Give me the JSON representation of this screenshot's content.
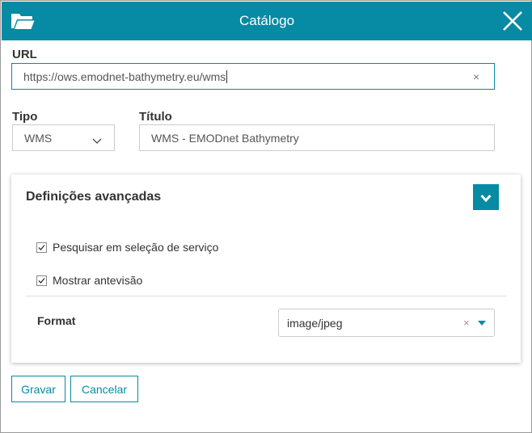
{
  "header": {
    "title": "Catálogo",
    "folder_icon": "folder-open-icon",
    "close_icon": "close-icon"
  },
  "form": {
    "url_label": "URL",
    "url_value": "https://ows.emodnet-bathymetry.eu/wms",
    "url_clear": "×",
    "type_label": "Tipo",
    "type_value": "WMS",
    "title_label": "Título",
    "title_value": "WMS - EMODnet Bathymetry"
  },
  "advanced": {
    "title": "Definições avançadas",
    "toggle_icon": "chevron-down-icon",
    "options": [
      {
        "label": "Pesquisar em seleção de serviço",
        "checked": true
      },
      {
        "label": "Mostrar antevisão",
        "checked": true
      }
    ],
    "format_label": "Format",
    "format_value": "image/jpeg",
    "format_clear": "×"
  },
  "actions": {
    "save_label": "Gravar",
    "cancel_label": "Cancelar"
  },
  "colors": {
    "accent": "#078aa3",
    "border": "#cccccc",
    "text": "#333333"
  }
}
